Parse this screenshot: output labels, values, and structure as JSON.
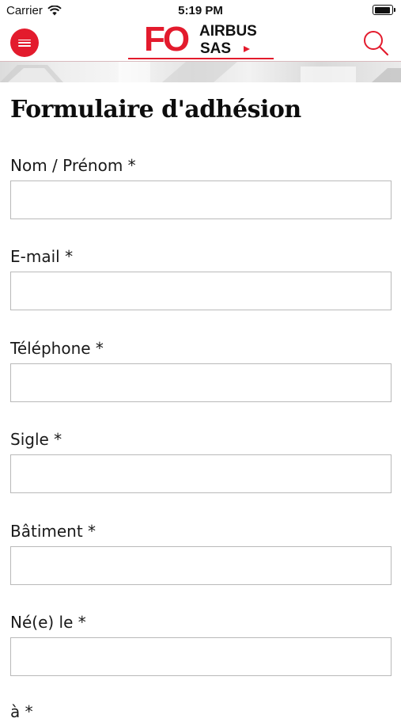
{
  "status_bar": {
    "carrier": "Carrier",
    "time": "5:19 PM"
  },
  "header": {
    "logo": {
      "fo": "FO",
      "airbus": "AIRBUS",
      "sas": "SAS"
    },
    "icons": {
      "menu": "hamburger-menu-icon",
      "search": "magnifier-search-icon"
    },
    "colors": {
      "brand_red": "#e31b2d"
    }
  },
  "form": {
    "title": "Formulaire d'adhésion",
    "fields": [
      {
        "label": "Nom / Prénom *",
        "value": ""
      },
      {
        "label": "E-mail *",
        "value": ""
      },
      {
        "label": "Téléphone *",
        "value": ""
      },
      {
        "label": "Sigle *",
        "value": ""
      },
      {
        "label": "Bâtiment *",
        "value": ""
      },
      {
        "label": "Né(e) le *",
        "value": ""
      },
      {
        "label": "à *",
        "value": ""
      }
    ]
  }
}
